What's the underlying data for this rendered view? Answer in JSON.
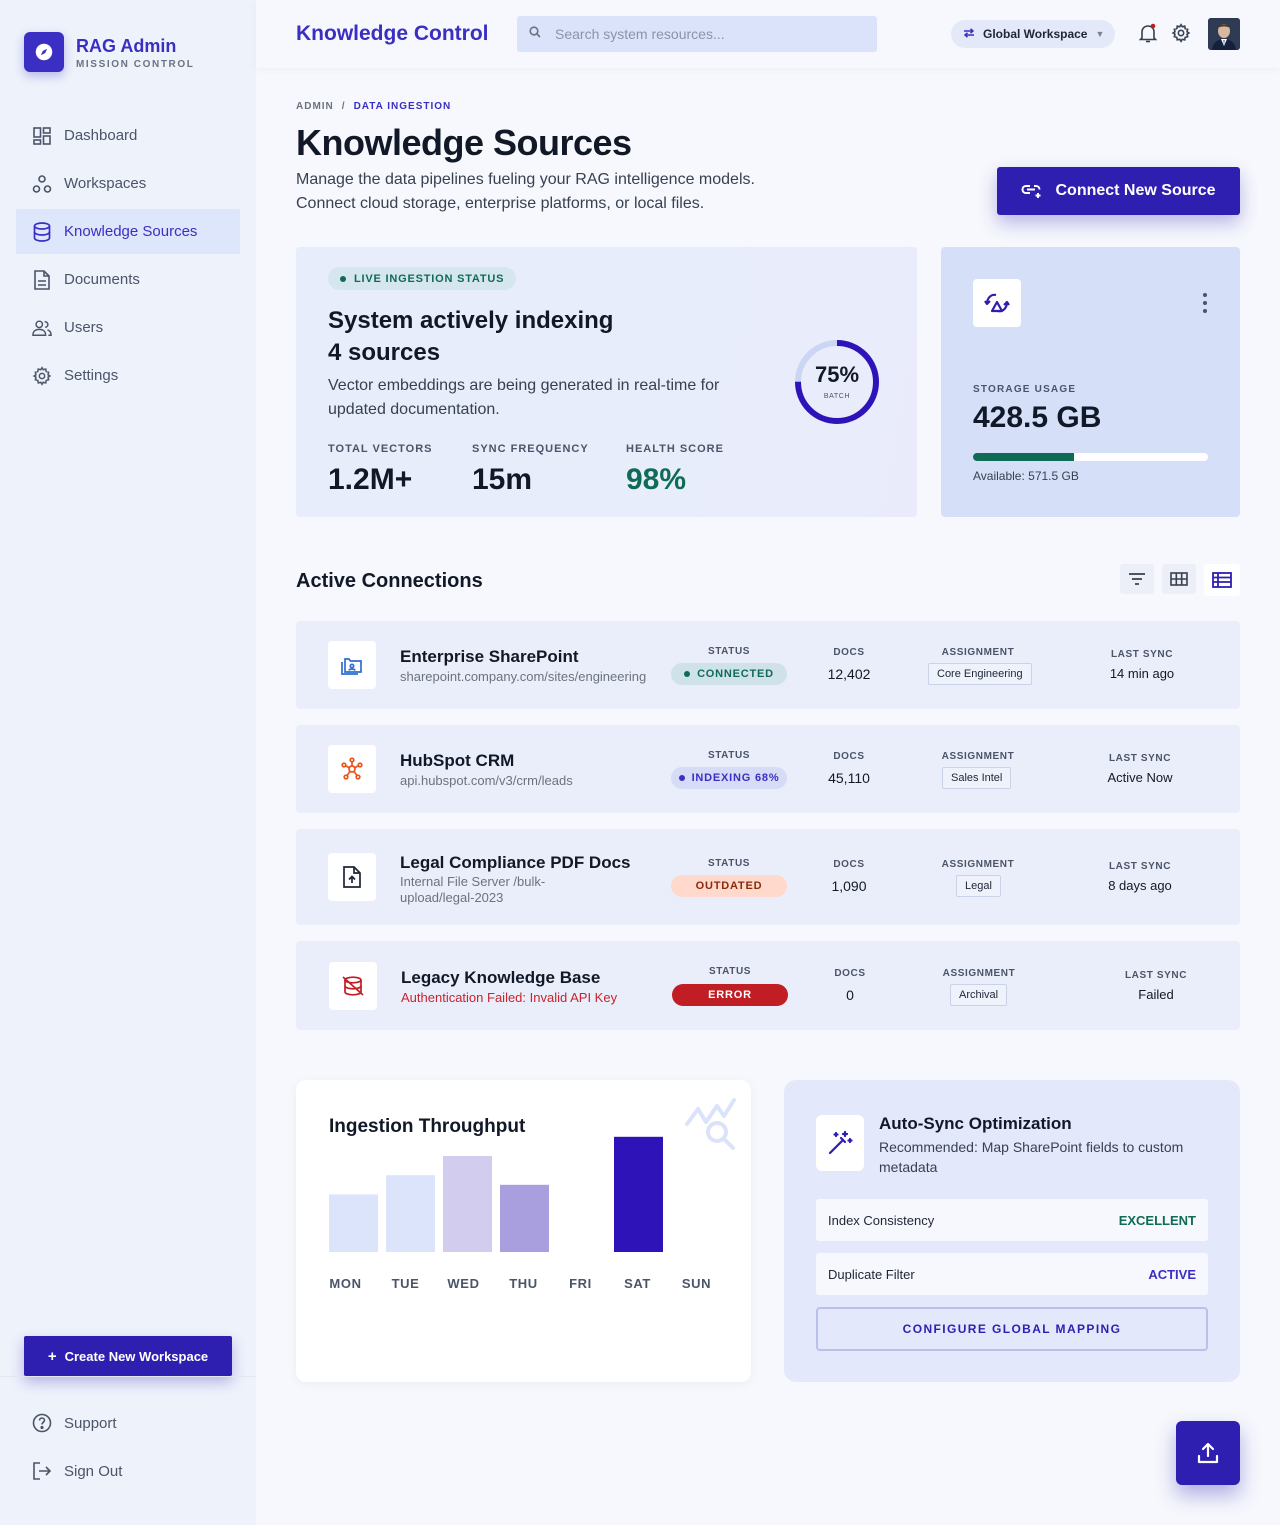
{
  "brand": {
    "title": "RAG Admin",
    "subtitle": "MISSION CONTROL"
  },
  "sidebar": {
    "items": [
      {
        "label": "Dashboard",
        "icon": "dashboard-icon"
      },
      {
        "label": "Workspaces",
        "icon": "workspaces-icon"
      },
      {
        "label": "Knowledge Sources",
        "icon": "database-icon",
        "active": true
      },
      {
        "label": "Documents",
        "icon": "document-icon"
      },
      {
        "label": "Users",
        "icon": "users-icon"
      },
      {
        "label": "Settings",
        "icon": "gear-icon"
      }
    ],
    "create_button": "Create New Workspace",
    "bottom": [
      {
        "label": "Support",
        "icon": "help-icon"
      },
      {
        "label": "Sign Out",
        "icon": "logout-icon"
      }
    ]
  },
  "header": {
    "title": "Knowledge Control",
    "search_placeholder": "Search system resources...",
    "workspace": "Global Workspace"
  },
  "breadcrumb": {
    "root": "ADMIN",
    "separator": "/",
    "current": "DATA INGESTION"
  },
  "page": {
    "title": "Knowledge Sources",
    "description_line1": "Manage the data pipelines fueling your RAG intelligence models.",
    "description_line2": "Connect cloud storage, enterprise platforms, or local files.",
    "connect_button": "Connect New Source"
  },
  "status_card": {
    "pill": "LIVE INGESTION STATUS",
    "title_line1": "System actively indexing",
    "title_line2": "4 sources",
    "description": "Vector embeddings are being generated in real-time for updated documentation.",
    "metrics": [
      {
        "label": "TOTAL VECTORS",
        "value": "1.2M+"
      },
      {
        "label": "SYNC FREQUENCY",
        "value": "15m"
      },
      {
        "label": "HEALTH SCORE",
        "value": "98%"
      }
    ],
    "batch_percent": 75,
    "batch_value": "75%",
    "batch_label": "BATCH"
  },
  "storage": {
    "label": "STORAGE USAGE",
    "value": "428.5 GB",
    "used_fraction": 0.43,
    "available": "Available: 571.5 GB"
  },
  "connections": {
    "title": "Active Connections",
    "columns": {
      "status": "STATUS",
      "docs": "DOCS",
      "assignment": "ASSIGNMENT",
      "last_sync": "LAST SYNC"
    },
    "rows": [
      {
        "name": "Enterprise SharePoint",
        "sub": "sharepoint.company.com/sites/engineering",
        "status": "CONNECTED",
        "docs": "12,402",
        "assignment": "Core Engineering",
        "last_sync": "14 min ago"
      },
      {
        "name": "HubSpot CRM",
        "sub": "api.hubspot.com/v3/crm/leads",
        "status": "INDEXING 68%",
        "docs": "45,110",
        "assignment": "Sales Intel",
        "last_sync": "Active Now"
      },
      {
        "name": "Legal Compliance PDF Docs",
        "sub": "Internal File Server /bulk-upload/legal-2023",
        "status": "OUTDATED",
        "docs": "1,090",
        "assignment": "Legal",
        "last_sync": "8 days ago"
      },
      {
        "name": "Legacy Knowledge Base",
        "sub": "Authentication Failed: Invalid API Key",
        "status": "ERROR",
        "docs": "0",
        "assignment": "Archival",
        "last_sync": "Failed"
      }
    ]
  },
  "throughput": {
    "title": "Ingestion Throughput",
    "chart_data": {
      "type": "bar",
      "categories": [
        "MON",
        "TUE",
        "WED",
        "THU",
        "FRI",
        "SAT",
        "SUN"
      ],
      "values": [
        48,
        64,
        80,
        56,
        0,
        96,
        0
      ],
      "colors": [
        "#dbe4fb",
        "#dbe4fb",
        "#d2cdef",
        "#a99fdf",
        "#dbe4fb",
        "#2e14b8",
        "#dbe4fb"
      ],
      "title": "Ingestion Throughput",
      "ylim": [
        0,
        100
      ]
    }
  },
  "autosync": {
    "title": "Auto-Sync Optimization",
    "description": "Recommended: Map SharePoint fields to custom metadata",
    "rows": [
      {
        "label": "Index Consistency",
        "value": "EXCELLENT"
      },
      {
        "label": "Duplicate Filter",
        "value": "ACTIVE"
      }
    ],
    "button": "CONFIGURE GLOBAL MAPPING"
  },
  "colors": {
    "accent": "#2e1fb0",
    "brand": "#3a2fc2",
    "success": "#0f6b55",
    "error": "#c01d24"
  }
}
